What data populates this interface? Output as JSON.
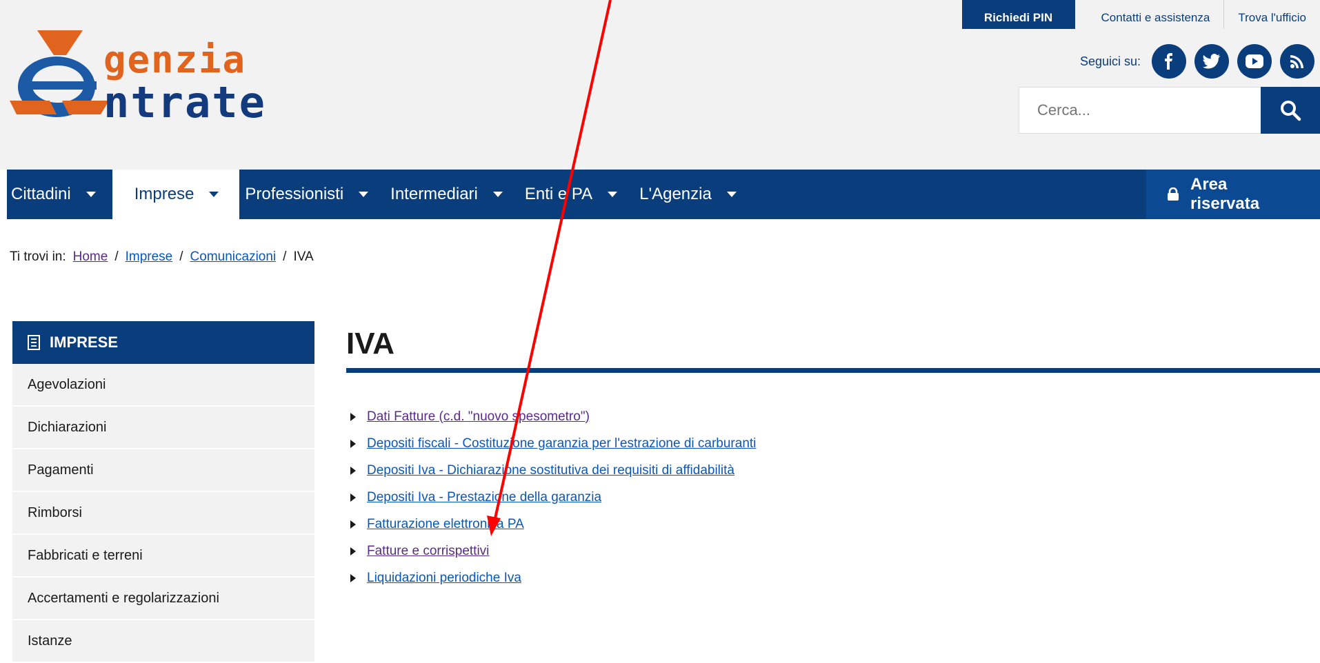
{
  "logo": {
    "line1": "genzia",
    "line2": "ntrate",
    "alt": "Agenzia Entrate"
  },
  "top_links": {
    "pin_button": "Richiedi PIN",
    "contact": "Contatti e assistenza",
    "office": "Trova l'ufficio"
  },
  "social": {
    "label": "Seguici su:",
    "icons": [
      "facebook-icon",
      "twitter-icon",
      "youtube-icon",
      "rss-icon"
    ]
  },
  "search": {
    "placeholder": "Cerca..."
  },
  "nav": {
    "items": [
      {
        "label": "Cittadini"
      },
      {
        "label": "Imprese"
      },
      {
        "label": "Professionisti"
      },
      {
        "label": "Intermediari"
      },
      {
        "label": "Enti e PA"
      },
      {
        "label": "L'Agenzia"
      }
    ],
    "active": "Imprese",
    "area_riservata": "Area riservata"
  },
  "breadcrumb": {
    "prefix": "Ti trovi in:",
    "items": [
      "Home",
      "Imprese",
      "Comunicazioni"
    ],
    "current": "IVA",
    "separator": "/"
  },
  "sidebar": {
    "title": "IMPRESE",
    "items": [
      "Agevolazioni",
      "Dichiarazioni",
      "Pagamenti",
      "Rimborsi",
      "Fabbricati e terreni",
      "Accertamenti e regolarizzazioni",
      "Istanze"
    ]
  },
  "main": {
    "title": "IVA",
    "links": [
      "Dati Fatture (c.d. \"nuovo spesometro\")",
      "Depositi fiscali - Costituzione garanzia per l'estrazione di carburanti",
      "Depositi Iva - Dichiarazione sostitutiva dei requisiti di affidabilità",
      "Depositi Iva - Prestazione della garanzia",
      "Fatturazione elettronica PA",
      "Fatture e corrispettivi",
      "Liquidazioni periodiche Iva"
    ]
  },
  "colors": {
    "brand_blue": "#0a3d7c",
    "logo_orange": "#e0631e",
    "link_blue": "#0b57b8",
    "visited_purple": "#5a2a8c",
    "annotation_red": "#ff0000"
  }
}
